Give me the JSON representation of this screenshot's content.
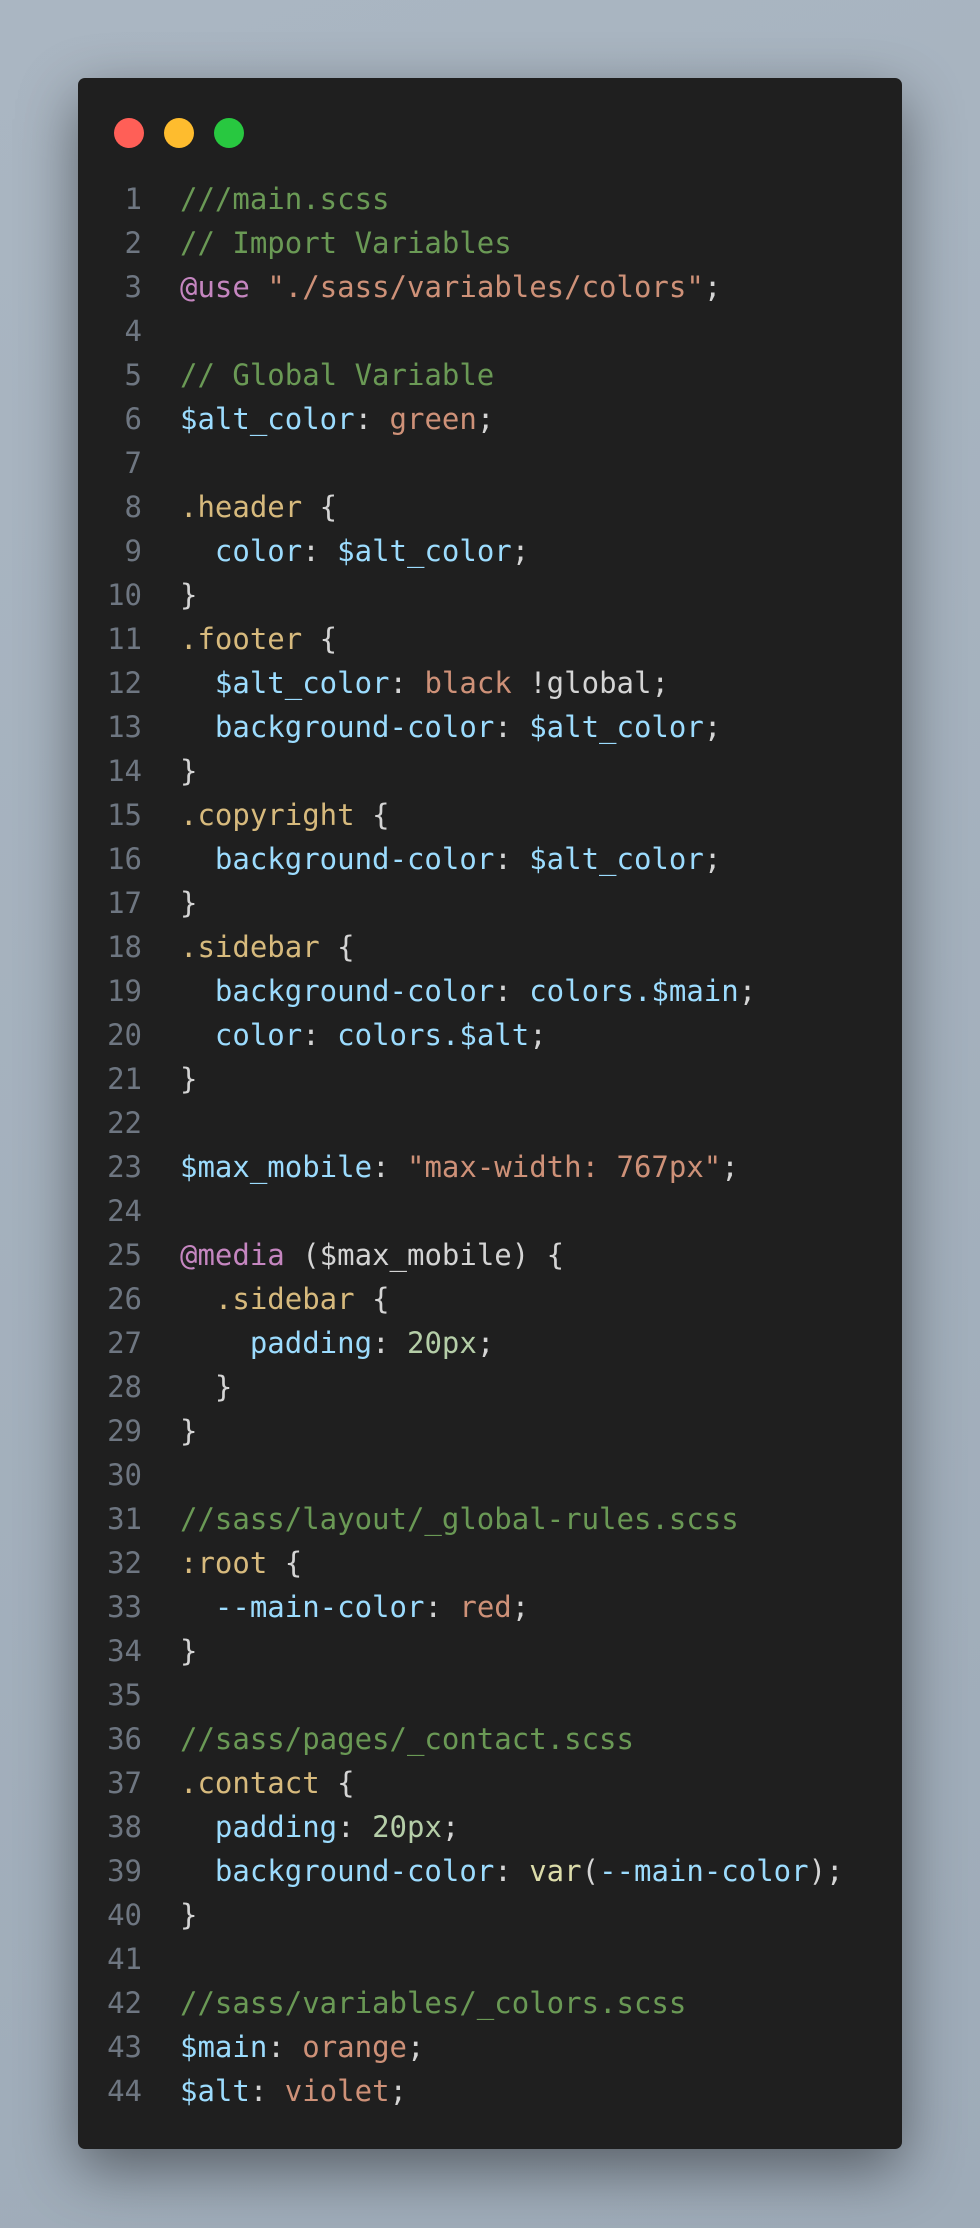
{
  "window": {
    "controls": [
      {
        "name": "close",
        "color": "#ff5f57"
      },
      {
        "name": "minimize",
        "color": "#febc2e"
      },
      {
        "name": "maximize",
        "color": "#28c840"
      }
    ]
  },
  "code": {
    "lines": [
      {
        "n": "1",
        "tokens": [
          {
            "t": "///main.scss",
            "c": "c"
          }
        ]
      },
      {
        "n": "2",
        "tokens": [
          {
            "t": "// Import Variables",
            "c": "c"
          }
        ]
      },
      {
        "n": "3",
        "tokens": [
          {
            "t": "@use",
            "c": "k"
          },
          {
            "t": " ",
            "c": "p"
          },
          {
            "t": "\"./sass/variables/colors\"",
            "c": "s"
          },
          {
            "t": ";",
            "c": "p"
          }
        ]
      },
      {
        "n": "4",
        "tokens": []
      },
      {
        "n": "5",
        "tokens": [
          {
            "t": "// Global Variable",
            "c": "c"
          }
        ]
      },
      {
        "n": "6",
        "tokens": [
          {
            "t": "$alt_color",
            "c": "v"
          },
          {
            "t": ": ",
            "c": "p"
          },
          {
            "t": "green",
            "c": "s"
          },
          {
            "t": ";",
            "c": "p"
          }
        ]
      },
      {
        "n": "7",
        "tokens": []
      },
      {
        "n": "8",
        "tokens": [
          {
            "t": ".header",
            "c": "sel"
          },
          {
            "t": " {",
            "c": "p"
          }
        ]
      },
      {
        "n": "9",
        "tokens": [
          {
            "t": "  ",
            "c": "p"
          },
          {
            "t": "color",
            "c": "v"
          },
          {
            "t": ": ",
            "c": "p"
          },
          {
            "t": "$alt_color",
            "c": "v"
          },
          {
            "t": ";",
            "c": "p"
          }
        ]
      },
      {
        "n": "10",
        "tokens": [
          {
            "t": "}",
            "c": "p"
          }
        ]
      },
      {
        "n": "11",
        "tokens": [
          {
            "t": ".footer",
            "c": "sel"
          },
          {
            "t": " {",
            "c": "p"
          }
        ]
      },
      {
        "n": "12",
        "tokens": [
          {
            "t": "  ",
            "c": "p"
          },
          {
            "t": "$alt_color",
            "c": "v"
          },
          {
            "t": ": ",
            "c": "p"
          },
          {
            "t": "black",
            "c": "s"
          },
          {
            "t": " !global;",
            "c": "p"
          }
        ]
      },
      {
        "n": "13",
        "tokens": [
          {
            "t": "  ",
            "c": "p"
          },
          {
            "t": "background-color",
            "c": "v"
          },
          {
            "t": ": ",
            "c": "p"
          },
          {
            "t": "$alt_color",
            "c": "v"
          },
          {
            "t": ";",
            "c": "p"
          }
        ]
      },
      {
        "n": "14",
        "tokens": [
          {
            "t": "}",
            "c": "p"
          }
        ]
      },
      {
        "n": "15",
        "tokens": [
          {
            "t": ".copyright",
            "c": "sel"
          },
          {
            "t": " {",
            "c": "p"
          }
        ]
      },
      {
        "n": "16",
        "tokens": [
          {
            "t": "  ",
            "c": "p"
          },
          {
            "t": "background-color",
            "c": "v"
          },
          {
            "t": ": ",
            "c": "p"
          },
          {
            "t": "$alt_color",
            "c": "v"
          },
          {
            "t": ";",
            "c": "p"
          }
        ]
      },
      {
        "n": "17",
        "tokens": [
          {
            "t": "}",
            "c": "p"
          }
        ]
      },
      {
        "n": "18",
        "tokens": [
          {
            "t": ".sidebar",
            "c": "sel"
          },
          {
            "t": " {",
            "c": "p"
          }
        ]
      },
      {
        "n": "19",
        "tokens": [
          {
            "t": "  ",
            "c": "p"
          },
          {
            "t": "background-color",
            "c": "v"
          },
          {
            "t": ": ",
            "c": "p"
          },
          {
            "t": "colors.$main",
            "c": "v"
          },
          {
            "t": ";",
            "c": "p"
          }
        ]
      },
      {
        "n": "20",
        "tokens": [
          {
            "t": "  ",
            "c": "p"
          },
          {
            "t": "color",
            "c": "v"
          },
          {
            "t": ": ",
            "c": "p"
          },
          {
            "t": "colors.$alt",
            "c": "v"
          },
          {
            "t": ";",
            "c": "p"
          }
        ]
      },
      {
        "n": "21",
        "tokens": [
          {
            "t": "}",
            "c": "p"
          }
        ]
      },
      {
        "n": "22",
        "tokens": []
      },
      {
        "n": "23",
        "tokens": [
          {
            "t": "$max_mobile",
            "c": "v"
          },
          {
            "t": ": ",
            "c": "p"
          },
          {
            "t": "\"max-width: 767px\"",
            "c": "s"
          },
          {
            "t": ";",
            "c": "p"
          }
        ]
      },
      {
        "n": "24",
        "tokens": []
      },
      {
        "n": "25",
        "tokens": [
          {
            "t": "@media",
            "c": "k"
          },
          {
            "t": " ($max_mobile) {",
            "c": "p"
          }
        ]
      },
      {
        "n": "26",
        "tokens": [
          {
            "t": "  ",
            "c": "p"
          },
          {
            "t": ".sidebar",
            "c": "sel"
          },
          {
            "t": " {",
            "c": "p"
          }
        ]
      },
      {
        "n": "27",
        "tokens": [
          {
            "t": "    ",
            "c": "p"
          },
          {
            "t": "padding",
            "c": "v"
          },
          {
            "t": ": ",
            "c": "p"
          },
          {
            "t": "20px",
            "c": "n"
          },
          {
            "t": ";",
            "c": "p"
          }
        ]
      },
      {
        "n": "28",
        "tokens": [
          {
            "t": "  }",
            "c": "p"
          }
        ]
      },
      {
        "n": "29",
        "tokens": [
          {
            "t": "}",
            "c": "p"
          }
        ]
      },
      {
        "n": "30",
        "tokens": []
      },
      {
        "n": "31",
        "tokens": [
          {
            "t": "//sass/layout/_global-rules.scss",
            "c": "c"
          }
        ]
      },
      {
        "n": "32",
        "tokens": [
          {
            "t": ":root",
            "c": "sel"
          },
          {
            "t": " {",
            "c": "p"
          }
        ]
      },
      {
        "n": "33",
        "tokens": [
          {
            "t": "  ",
            "c": "p"
          },
          {
            "t": "--main-color",
            "c": "v"
          },
          {
            "t": ": ",
            "c": "p"
          },
          {
            "t": "red",
            "c": "s"
          },
          {
            "t": ";",
            "c": "p"
          }
        ]
      },
      {
        "n": "34",
        "tokens": [
          {
            "t": "}",
            "c": "p"
          }
        ]
      },
      {
        "n": "35",
        "tokens": []
      },
      {
        "n": "36",
        "tokens": [
          {
            "t": "//sass/pages/_contact.scss",
            "c": "c"
          }
        ]
      },
      {
        "n": "37",
        "tokens": [
          {
            "t": ".contact",
            "c": "sel"
          },
          {
            "t": " {",
            "c": "p"
          }
        ]
      },
      {
        "n": "38",
        "tokens": [
          {
            "t": "  ",
            "c": "p"
          },
          {
            "t": "padding",
            "c": "v"
          },
          {
            "t": ": ",
            "c": "p"
          },
          {
            "t": "20px",
            "c": "n"
          },
          {
            "t": ";",
            "c": "p"
          }
        ]
      },
      {
        "n": "39",
        "tokens": [
          {
            "t": "  ",
            "c": "p"
          },
          {
            "t": "background-color",
            "c": "v"
          },
          {
            "t": ": ",
            "c": "p"
          },
          {
            "t": "var",
            "c": "f"
          },
          {
            "t": "(",
            "c": "p"
          },
          {
            "t": "--main-color",
            "c": "v"
          },
          {
            "t": ");",
            "c": "p"
          }
        ]
      },
      {
        "n": "40",
        "tokens": [
          {
            "t": "}",
            "c": "p"
          }
        ]
      },
      {
        "n": "41",
        "tokens": []
      },
      {
        "n": "42",
        "tokens": [
          {
            "t": "//sass/variables/_colors.scss",
            "c": "c"
          }
        ]
      },
      {
        "n": "43",
        "tokens": [
          {
            "t": "$main",
            "c": "v"
          },
          {
            "t": ": ",
            "c": "p"
          },
          {
            "t": "orange",
            "c": "s"
          },
          {
            "t": ";",
            "c": "p"
          }
        ]
      },
      {
        "n": "44",
        "tokens": [
          {
            "t": "$alt",
            "c": "v"
          },
          {
            "t": ": ",
            "c": "p"
          },
          {
            "t": "violet",
            "c": "s"
          },
          {
            "t": ";",
            "c": "p"
          }
        ]
      }
    ]
  }
}
